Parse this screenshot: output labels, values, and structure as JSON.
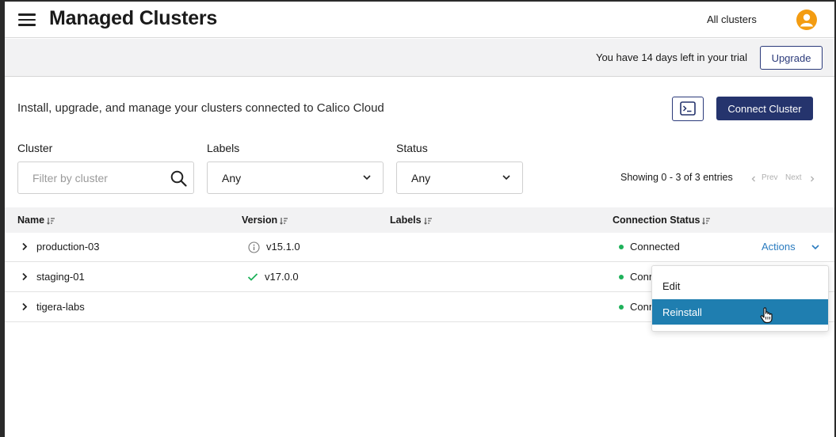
{
  "header": {
    "title": "Managed Clusters",
    "cluster_selector": "All clusters",
    "menu_icon": "hamburger-menu-icon",
    "avatar_icon": "user-avatar-icon"
  },
  "trial": {
    "message": "You have 14 days left in your trial",
    "upgrade_label": "Upgrade"
  },
  "intro": {
    "text": "Install, upgrade, and manage your clusters connected to Calico Cloud",
    "terminal_icon": "terminal-icon",
    "connect_label": "Connect Cluster"
  },
  "filters": {
    "cluster_label": "Cluster",
    "cluster_placeholder": "Filter by cluster",
    "labels_label": "Labels",
    "labels_value": "Any",
    "status_label": "Status",
    "status_value": "Any"
  },
  "pagination": {
    "showing": "Showing 0 - 3 of 3 entries",
    "prev": "Prev",
    "next": "Next"
  },
  "table": {
    "columns": [
      "Name",
      "Version",
      "Labels",
      "Connection Status"
    ],
    "rows": [
      {
        "name": "production-03",
        "version": "v15.1.0",
        "version_icon": "info-icon",
        "status": "Connected",
        "actions": "Actions"
      },
      {
        "name": "staging-01",
        "version": "v17.0.0",
        "version_icon": "check-icon",
        "status": "Conn"
      },
      {
        "name": "tigera-labs",
        "version": "",
        "status": "Conn"
      }
    ]
  },
  "menu": {
    "items": [
      "Edit",
      "Reinstall"
    ],
    "highlighted": "Reinstall"
  },
  "colors": {
    "primary": "#25346d",
    "accent": "#2a7bbf",
    "highlight": "#1f7eb0",
    "connected": "#1eb15a",
    "avatar": "#f39c12",
    "check": "#1eb15a"
  }
}
